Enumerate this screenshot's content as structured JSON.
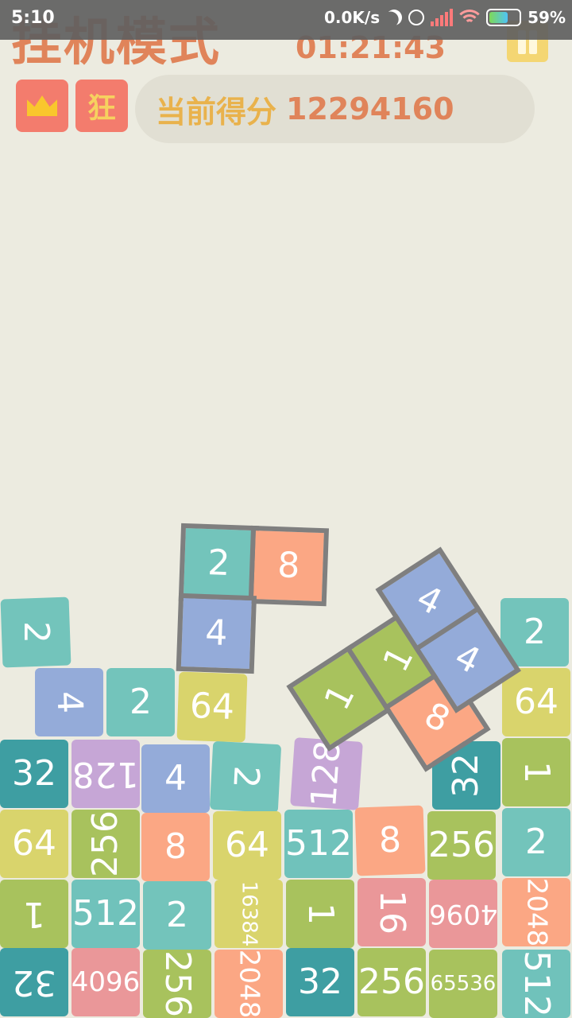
{
  "status_bar": {
    "time": "5:10",
    "net_speed": "0.0K/s",
    "battery": "59%"
  },
  "header": {
    "mode_title": "挂机模式",
    "timer": "01:21:43",
    "crazy_badge": "狂",
    "score_label": "当前得分",
    "score_value": "12294160"
  },
  "colors": {
    "2": "#73c4bb",
    "4": "#94abd9",
    "8": "#fba784",
    "16": "#ea9799",
    "32": "#3e9ea2",
    "64": "#d9d46c",
    "128": "#c6a6d6",
    "256": "#a8c25d",
    "512": "#70c2bb",
    "1": "#a8c25d",
    "1024": "#a8c25d",
    "2048": "#fba784",
    "4096": "#ea9799",
    "16384": "#d9d46c",
    "65536": "#a8c25d"
  },
  "board_tiles": [
    {
      "v": "2",
      "c": "2",
      "rot": 92
    },
    {
      "v": "4",
      "c": "4",
      "rot": 88
    },
    {
      "v": "2",
      "c": "2",
      "rot": 0
    },
    {
      "v": "64",
      "c": "64",
      "rot": 0
    },
    {
      "v": "2",
      "c": "2",
      "rot": 0
    },
    {
      "v": "64",
      "c": "64",
      "rot": 0
    },
    {
      "v": "32",
      "c": "32",
      "rot": 0
    },
    {
      "v": "128",
      "c": "128",
      "rot": 180
    },
    {
      "v": "4",
      "c": "4",
      "rot": 0
    },
    {
      "v": "2",
      "c": "2",
      "rot": 90
    },
    {
      "v": "128",
      "c": "128",
      "rot": -90
    },
    {
      "v": "32",
      "c": "32",
      "rot": -90
    },
    {
      "v": "1",
      "c": "1",
      "rot": 90
    },
    {
      "v": "64",
      "c": "64",
      "rot": 0
    },
    {
      "v": "256",
      "c": "256",
      "rot": -90
    },
    {
      "v": "8",
      "c": "8",
      "rot": 0
    },
    {
      "v": "64",
      "c": "64",
      "rot": 0
    },
    {
      "v": "512",
      "c": "512",
      "rot": 0
    },
    {
      "v": "8",
      "c": "8",
      "rot": 0
    },
    {
      "v": "256",
      "c": "256",
      "rot": 0
    },
    {
      "v": "2",
      "c": "2",
      "rot": 0
    },
    {
      "v": "1",
      "c": "1",
      "rot": 180
    },
    {
      "v": "512",
      "c": "512",
      "rot": 0
    },
    {
      "v": "2",
      "c": "2",
      "rot": 0
    },
    {
      "v": "16384",
      "c": "16384",
      "rot": 90
    },
    {
      "v": "1",
      "c": "1",
      "rot": 90
    },
    {
      "v": "16",
      "c": "16",
      "rot": 90
    },
    {
      "v": "4096",
      "c": "4096",
      "rot": 180
    },
    {
      "v": "2048",
      "c": "2048",
      "rot": 90
    },
    {
      "v": "32",
      "c": "32",
      "rot": 180
    },
    {
      "v": "4096",
      "c": "4096",
      "rot": 0
    },
    {
      "v": "256",
      "c": "256",
      "rot": 90
    },
    {
      "v": "2048",
      "c": "2048",
      "rot": 90
    },
    {
      "v": "32",
      "c": "32",
      "rot": 0
    },
    {
      "v": "256",
      "c": "256",
      "rot": 0
    },
    {
      "v": "65536",
      "c": "65536",
      "rot": 0
    },
    {
      "v": "512",
      "c": "512",
      "rot": 90
    }
  ],
  "falling_pieces": [
    {
      "tiles": [
        {
          "v": "2",
          "c": "2",
          "rot": 0
        },
        {
          "v": "8",
          "c": "8",
          "rot": 0
        },
        {
          "v": "4",
          "c": "4",
          "rot": 0
        }
      ]
    },
    {
      "tiles": [
        {
          "v": "1",
          "c": "1",
          "rot": -30
        },
        {
          "v": "1",
          "c": "1",
          "rot": -30
        },
        {
          "v": "8",
          "c": "8",
          "rot": 60
        }
      ]
    },
    {
      "tiles": [
        {
          "v": "4",
          "c": "4",
          "rot": 60
        },
        {
          "v": "4",
          "c": "4",
          "rot": 60
        }
      ]
    }
  ]
}
